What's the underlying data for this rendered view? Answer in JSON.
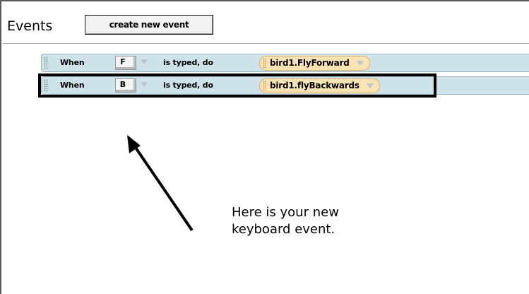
{
  "header": {
    "title": "Events",
    "create_button_label": "create new event"
  },
  "events": [
    {
      "when_label": "When",
      "key": "F",
      "typed_label": "is typed,  do",
      "method": "bird1.FlyForward"
    },
    {
      "when_label": "When",
      "key": "B",
      "typed_label": "is typed,  do",
      "method": "bird1.flyBackwards"
    }
  ],
  "callout": {
    "line1": "Here is your new",
    "line2": "keyboard event."
  },
  "icons": {
    "key_dropdown": "triangle-down-icon",
    "method_dropdown": "triangle-down-icon",
    "pointer": "arrow-icon"
  }
}
